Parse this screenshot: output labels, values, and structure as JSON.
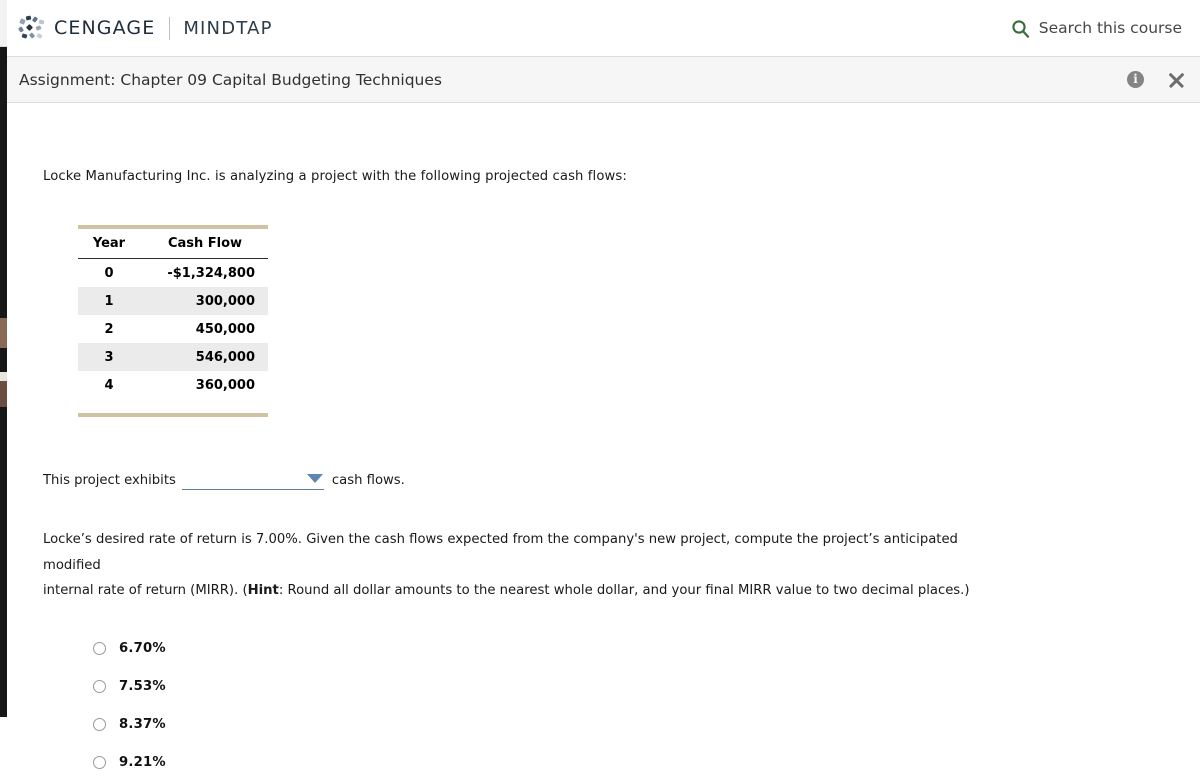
{
  "brand": {
    "logo_icon": "cengage-dots-icon",
    "cengage": "CENGAGE",
    "mindtap": "MINDTAP",
    "search_icon": "search-icon",
    "search_label": "Search this course",
    "search_icon_color": "#3d6b3d",
    "text_color": "#1f2d3a"
  },
  "assignment": {
    "title": "Assignment: Chapter 09 Capital Budgeting Techniques",
    "info_icon": "info-icon",
    "info_glyph": "i",
    "close_icon": "close-icon",
    "bar_bg": "#f6f6f6"
  },
  "main": {
    "intro": "Locke Manufacturing Inc. is analyzing a project with the following projected cash flows:",
    "table": {
      "accent_rule_color": "#cfc3a3",
      "stripe_color": "#ebebeb",
      "headers": [
        "Year",
        "Cash Flow"
      ],
      "rows": [
        {
          "year": "0",
          "cash_flow": "-$1,324,800"
        },
        {
          "year": "1",
          "cash_flow": "300,000"
        },
        {
          "year": "2",
          "cash_flow": "450,000"
        },
        {
          "year": "3",
          "cash_flow": "546,000"
        },
        {
          "year": "4",
          "cash_flow": "360,000"
        }
      ]
    },
    "dropdown_sentence": {
      "before": "This project exhibits",
      "selected_value": "",
      "placeholder": "",
      "after": "cash flows.",
      "caret_icon": "chevron-down-icon",
      "underline_color": "#5b7fa6"
    },
    "question": {
      "line1_a": "Locke’s desired rate of return is 7.00%. Given the cash flows expected from the company's new project, compute the project’s anticipated modified",
      "line2_a": "internal rate of return (MIRR). (",
      "hint_label": "Hint",
      "line2_b": ": Round all dollar amounts to the nearest whole dollar, and your final MIRR value to two decimal places.)"
    },
    "options": [
      {
        "label": "6.70%",
        "selected": false
      },
      {
        "label": "7.53%",
        "selected": false
      },
      {
        "label": "8.37%",
        "selected": false
      },
      {
        "label": "9.21%",
        "selected": false
      }
    ]
  }
}
